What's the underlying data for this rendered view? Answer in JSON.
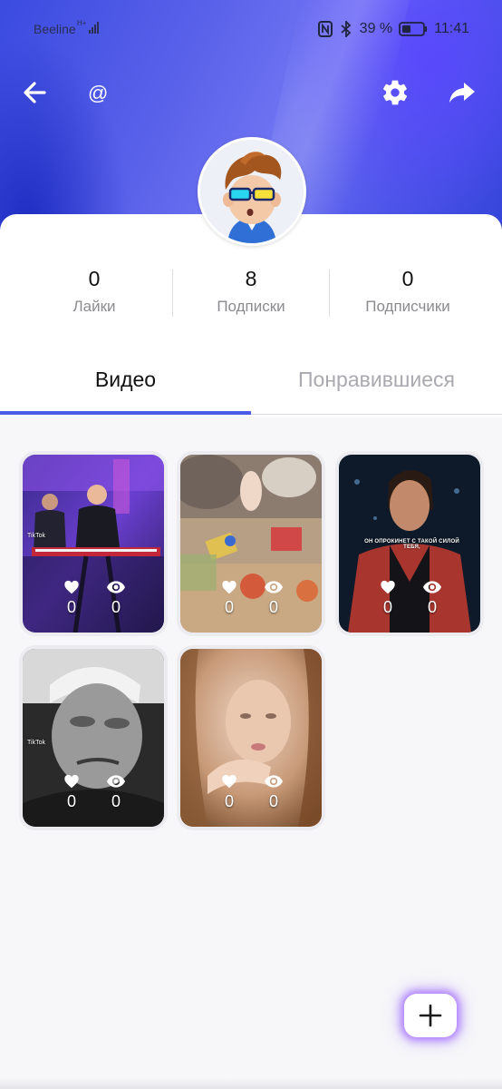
{
  "status_bar": {
    "carrier": "Beeline",
    "network": "H+",
    "battery": "39 %",
    "time": "11:41"
  },
  "header": {
    "username": "@",
    "icons": [
      "arrow-back-icon",
      "gear-icon",
      "share-icon"
    ]
  },
  "stats": [
    {
      "value": "0",
      "label": "Лайки"
    },
    {
      "value": "8",
      "label": "Подписки"
    },
    {
      "value": "0",
      "label": "Подписчики"
    }
  ],
  "tabs": [
    {
      "label": "Видео",
      "active": true
    },
    {
      "label": "Понравившиеся",
      "active": false
    }
  ],
  "videos": [
    {
      "likes": "0",
      "views": "0",
      "watermark": "TikTok"
    },
    {
      "likes": "0",
      "views": "0"
    },
    {
      "likes": "0",
      "views": "0",
      "caption": "ОН ОПРОКИНЕТ С ТАКОЙ СИЛОЙ ТЕБЯ,"
    },
    {
      "likes": "0",
      "views": "0",
      "watermark": "TikTok"
    },
    {
      "likes": "0",
      "views": "0"
    }
  ],
  "fab": {
    "icon": "plus-icon"
  },
  "colors": {
    "accent": "#4b5ce6",
    "header": "#5a62ea",
    "inactive_tab": "#a9a9b0"
  }
}
